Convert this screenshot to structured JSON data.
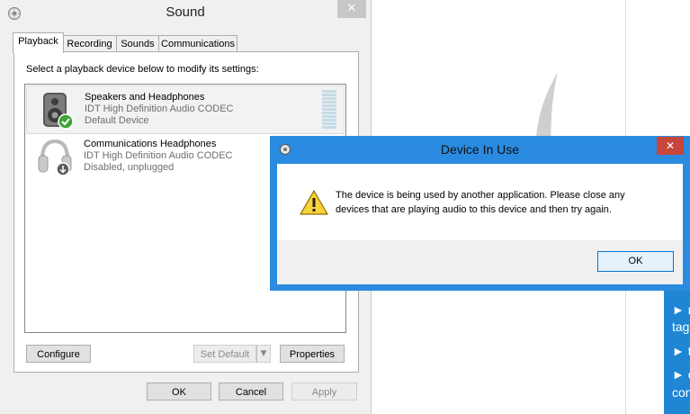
{
  "sound_window": {
    "title": "Sound",
    "close_glyph": "✕",
    "tabs": [
      {
        "label": "Playback",
        "active": true
      },
      {
        "label": "Recording",
        "active": false
      },
      {
        "label": "Sounds",
        "active": false
      },
      {
        "label": "Communications",
        "active": false
      }
    ],
    "instruction": "Select a playback device below to modify its settings:",
    "devices": [
      {
        "name": "Speakers and Headphones",
        "description": "IDT High Definition Audio CODEC",
        "status": "Default Device",
        "icon": "speaker-icon",
        "badge": "green-check-badge",
        "selected": true
      },
      {
        "name": "Communications Headphones",
        "description": "IDT High Definition Audio CODEC",
        "status": "Disabled, unplugged",
        "icon": "headphones-icon",
        "badge": "down-arrow-badge",
        "selected": false
      }
    ],
    "buttons": {
      "configure": "Configure",
      "set_default": "Set Default",
      "set_default_arrow": "▼",
      "properties": "Properties",
      "ok": "OK",
      "cancel": "Cancel",
      "apply": "Apply"
    }
  },
  "dialog": {
    "title": "Device In Use",
    "close_glyph": "✕",
    "message": "The device is being used by another application.  Please close any devices that are playing audio to this device and then try again.",
    "ok": "OK",
    "icon": "warning-icon",
    "accent_color": "#2a8be0",
    "close_color": "#c7463b"
  },
  "background_panel": {
    "color": "#1f86d4",
    "lines": [
      "► n",
      "tag",
      "► t",
      "► c",
      "con"
    ]
  }
}
